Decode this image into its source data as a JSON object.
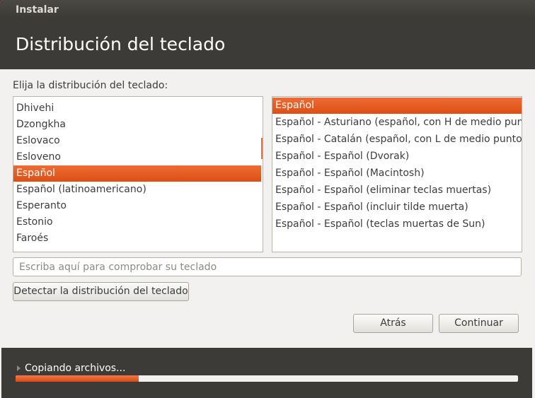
{
  "window": {
    "title": "Instalar"
  },
  "header": {
    "title": "Distribución del teclado"
  },
  "prompt": "Elija la distribución del teclado:",
  "layouts": [
    {
      "label": "Dhivehi",
      "selected": false
    },
    {
      "label": "Dzongkha",
      "selected": false
    },
    {
      "label": "Eslovaco",
      "selected": false
    },
    {
      "label": "Esloveno",
      "selected": false
    },
    {
      "label": "Español",
      "selected": true
    },
    {
      "label": "Español (latinoamericano)",
      "selected": false
    },
    {
      "label": "Esperanto",
      "selected": false
    },
    {
      "label": "Estonio",
      "selected": false
    },
    {
      "label": "Faroés",
      "selected": false
    }
  ],
  "variants": [
    {
      "label": "Español",
      "selected": true
    },
    {
      "label": "Español - Asturiano (español, con H de medio punto y",
      "selected": false
    },
    {
      "label": "Español - Catalán (español, con L de medio punto)",
      "selected": false
    },
    {
      "label": "Español - Español (Dvorak)",
      "selected": false
    },
    {
      "label": "Español - Español (Macintosh)",
      "selected": false
    },
    {
      "label": "Español - Español (eliminar teclas muertas)",
      "selected": false
    },
    {
      "label": "Español - Español (incluir tilde muerta)",
      "selected": false
    },
    {
      "label": "Español - Español (teclas muertas de Sun)",
      "selected": false
    }
  ],
  "test_input": {
    "placeholder": "Escriba aquí para comprobar su teclado",
    "value": ""
  },
  "buttons": {
    "detect": "Detectar la distribución del teclado",
    "back": "Atrás",
    "continue": "Continuar"
  },
  "progress": {
    "label": "Copiando archivos...",
    "fraction": 0.245
  },
  "colors": {
    "accent": "#dd4814",
    "header_bg": "#3c3b37"
  }
}
